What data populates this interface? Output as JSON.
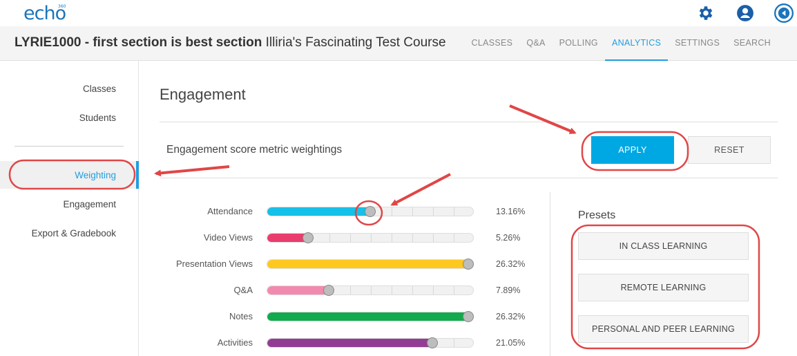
{
  "brand": {
    "logo_text": "echo",
    "logo_sup": "360"
  },
  "header": {
    "course_code": "LYRIE1000 - first section is best section",
    "course_name": "Illiria's Fascinating Test Course",
    "tabs": [
      "CLASSES",
      "Q&A",
      "POLLING",
      "ANALYTICS",
      "SETTINGS",
      "SEARCH"
    ],
    "active_tab": "ANALYTICS",
    "icons": [
      "gear-icon",
      "user-account-icon",
      "collapse-icon"
    ]
  },
  "sidebar": {
    "items": [
      "Classes",
      "Students",
      "Weighting",
      "Engagement",
      "Export & Gradebook"
    ],
    "active": "Weighting"
  },
  "main": {
    "title": "Engagement",
    "subtitle": "Engagement score metric weightings",
    "apply_label": "APPLY",
    "reset_label": "RESET"
  },
  "metrics": [
    {
      "label": "Attendance",
      "percent": "13.16%",
      "level": 0.5,
      "color": "#16c0e8"
    },
    {
      "label": "Video Views",
      "percent": "5.26%",
      "level": 0.2,
      "color": "#ea3c6d"
    },
    {
      "label": "Presentation Views",
      "percent": "26.32%",
      "level": 1.0,
      "color": "#ffc81e"
    },
    {
      "label": "Q&A",
      "percent": "7.89%",
      "level": 0.3,
      "color": "#f28aaf"
    },
    {
      "label": "Notes",
      "percent": "26.32%",
      "level": 1.0,
      "color": "#12aa4c"
    },
    {
      "label": "Activities",
      "percent": "21.05%",
      "level": 0.8,
      "color": "#913e92"
    }
  ],
  "presets": {
    "title": "Presets",
    "buttons": [
      "IN CLASS LEARNING",
      "REMOTE LEARNING",
      "PERSONAL AND PEER LEARNING"
    ]
  },
  "colors": {
    "accent": "#1e9ee0",
    "apply": "#00a8e3",
    "annotation": "#e04646"
  }
}
